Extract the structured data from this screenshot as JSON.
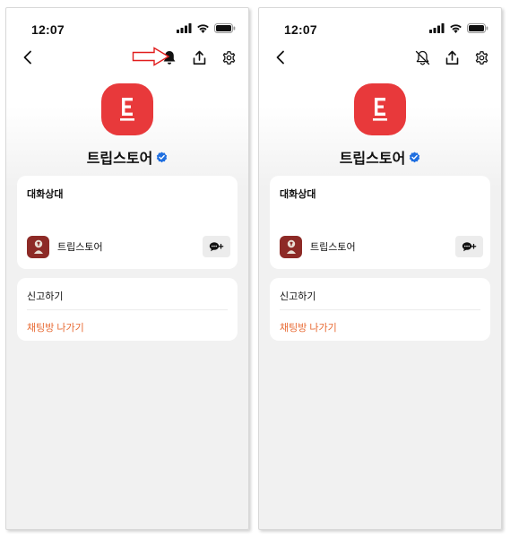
{
  "colors": {
    "brand_red": "#e8393b",
    "avatar_bg": "#8d2a26",
    "leave_text": "#e86a33",
    "verified_blue": "#1f6fe0",
    "annotation_red": "#e11d1d"
  },
  "panels": [
    {
      "status_time": "12:07",
      "notification_icon": "bell-icon",
      "profile_name": "트립스토어",
      "logo_letter": "E",
      "participants_title": "대화상대",
      "member_name": "트립스토어",
      "report_label": "신고하기",
      "leave_label": "채팅방 나가기"
    },
    {
      "status_time": "12:07",
      "notification_icon": "bell-off-icon",
      "profile_name": "트립스토어",
      "logo_letter": "E",
      "participants_title": "대화상대",
      "member_name": "트립스토어",
      "report_label": "신고하기",
      "leave_label": "채팅방 나가기"
    }
  ]
}
